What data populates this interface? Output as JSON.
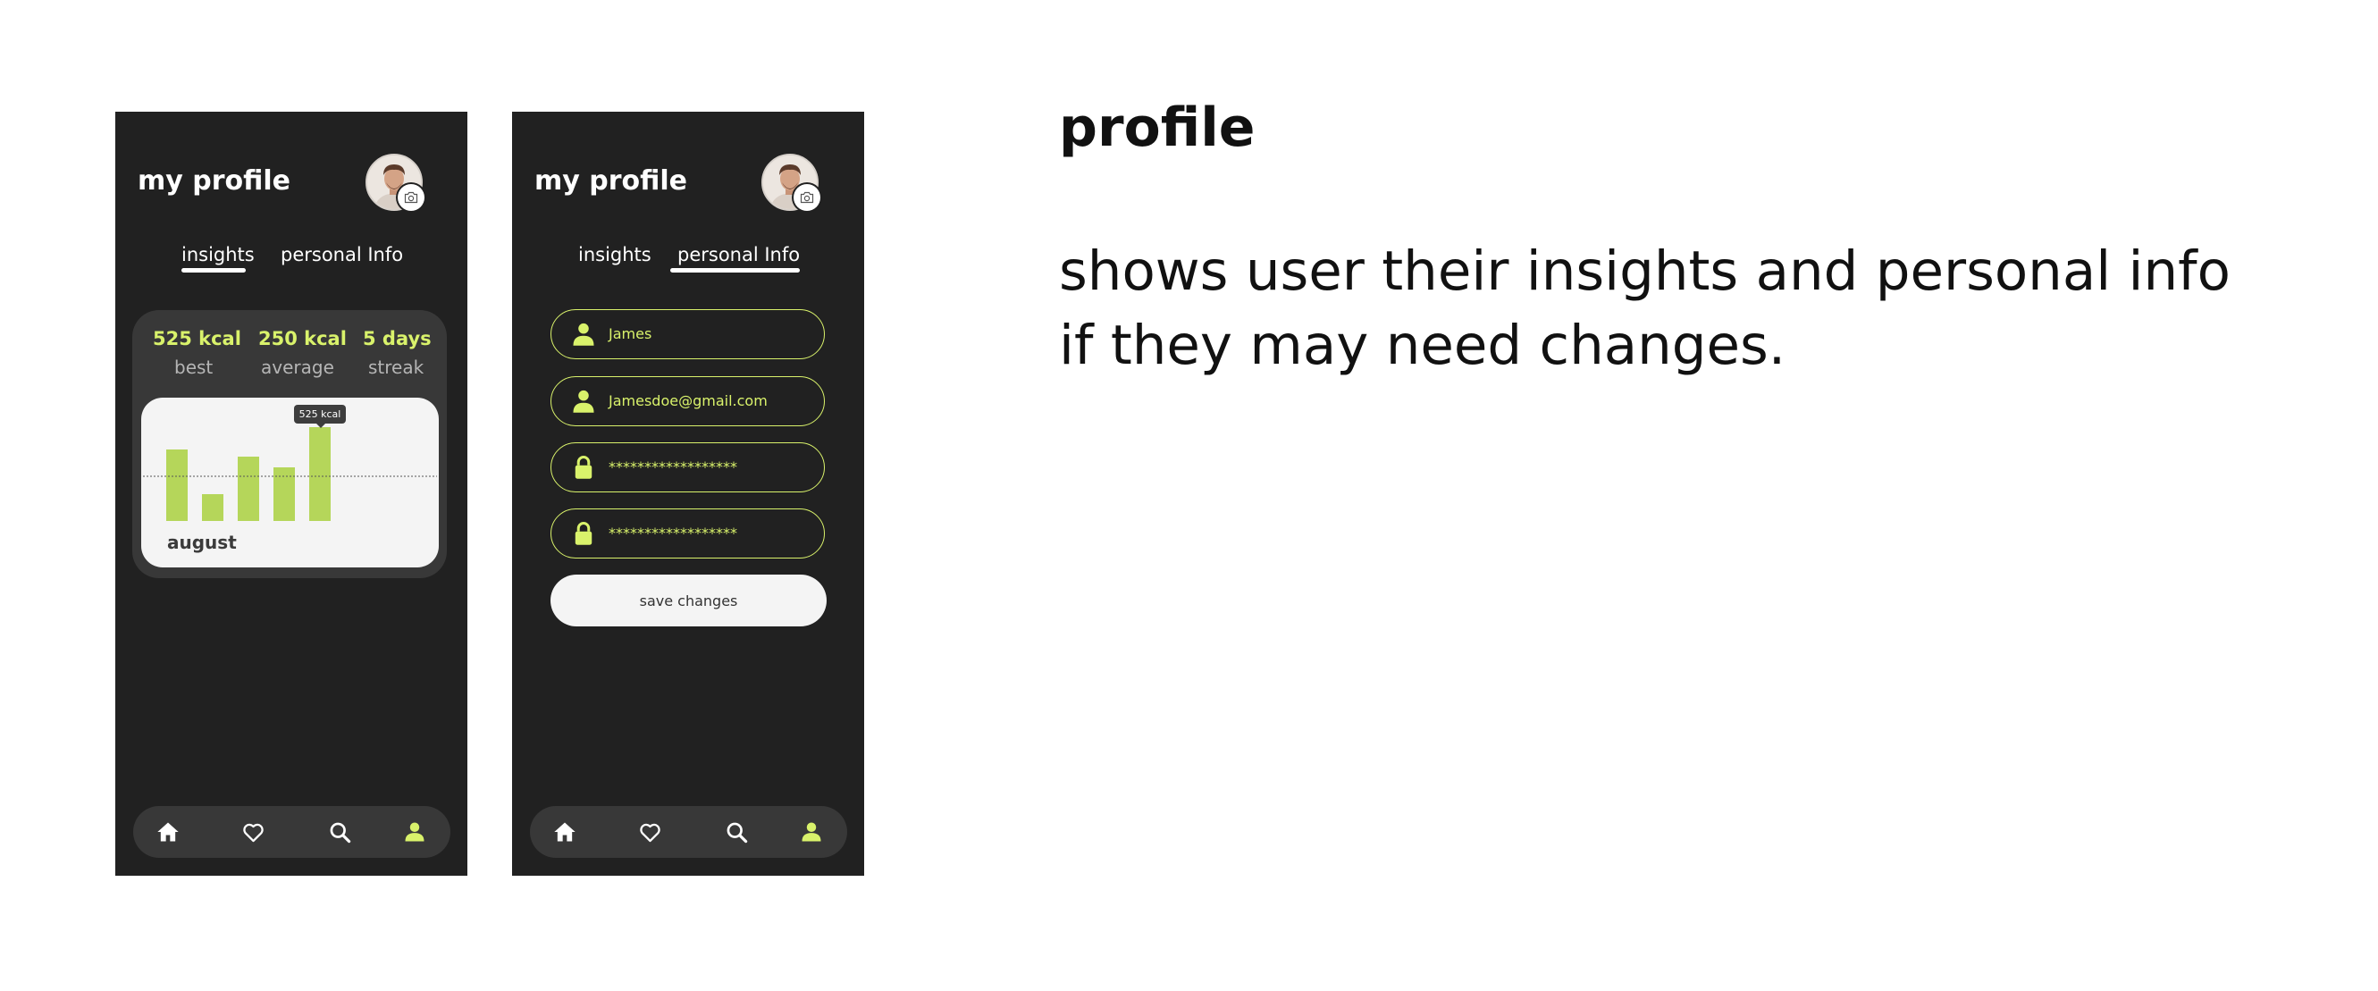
{
  "colors": {
    "phone_bg": "#212121",
    "card_bg": "#383838",
    "accent": "#d9f26b",
    "bar_green": "#b5d65a",
    "text_light": "#ffffff"
  },
  "insights_screen": {
    "title": "my profile",
    "tabs": [
      {
        "label": "insights",
        "active": true
      },
      {
        "label": "personal Info",
        "active": false
      }
    ],
    "stats": [
      {
        "value": "525 kcal",
        "label": "best"
      },
      {
        "value": "250 kcal",
        "label": "average"
      },
      {
        "value": "5 days",
        "label": "streak"
      }
    ],
    "tooltip": "525 kcal",
    "month": "august"
  },
  "personal_screen": {
    "title": "my profile",
    "tabs": [
      {
        "label": "insights",
        "active": false
      },
      {
        "label": "personal Info",
        "active": true
      }
    ],
    "fields": [
      {
        "icon": "user-icon",
        "value": "James"
      },
      {
        "icon": "user-icon",
        "value": "Jamesdoe@gmail.com"
      },
      {
        "icon": "lock-icon",
        "value": "******************"
      },
      {
        "icon": "lock-icon",
        "value": "******************"
      }
    ],
    "save_label": "save changes"
  },
  "nav": [
    {
      "icon": "home-icon",
      "active": false
    },
    {
      "icon": "heart-icon",
      "active": false
    },
    {
      "icon": "search-icon",
      "active": false
    },
    {
      "icon": "user-icon",
      "active": true
    }
  ],
  "chart_data": {
    "type": "bar",
    "categories": [
      "",
      "",
      "",
      "",
      ""
    ],
    "values": [
      400,
      150,
      360,
      300,
      525
    ],
    "reference_line": 250,
    "ylim": [
      0,
      600
    ],
    "title": "",
    "xlabel": "august",
    "ylabel": ""
  },
  "description": {
    "heading": "profile",
    "text": "shows user their insights and personal info if they may need changes."
  }
}
